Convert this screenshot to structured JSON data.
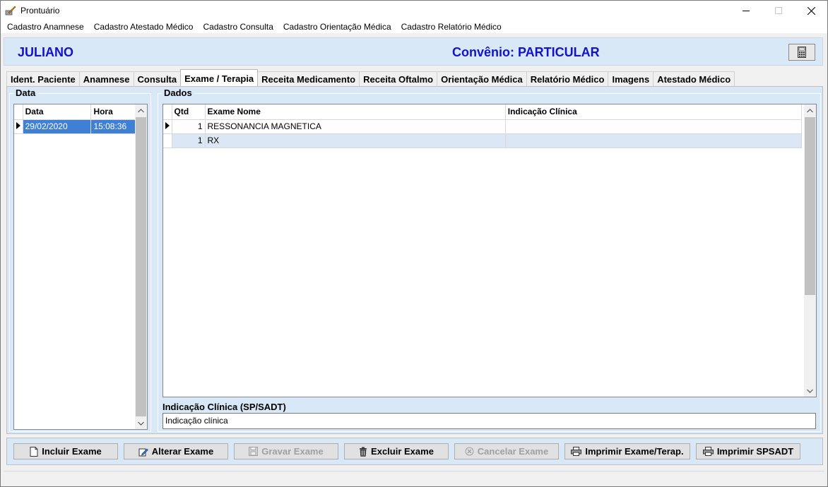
{
  "window": {
    "title": "Prontuário"
  },
  "menu": [
    "Cadastro Anamnese",
    "Cadastro Atestado Médico",
    "Cadastro Consulta",
    "Cadastro Orientação Médica",
    "Cadastro Relatório Médico"
  ],
  "header": {
    "patient_name": "JULIANO",
    "convenio": "Convênio: PARTICULAR"
  },
  "tabs": [
    {
      "label": "Ident. Paciente",
      "active": false
    },
    {
      "label": "Anamnese",
      "active": false
    },
    {
      "label": "Consulta",
      "active": false
    },
    {
      "label": "Exame / Terapia",
      "active": true
    },
    {
      "label": "Receita Medicamento",
      "active": false
    },
    {
      "label": "Receita Oftalmo",
      "active": false
    },
    {
      "label": "Orientação Médica",
      "active": false
    },
    {
      "label": "Relatório Médico",
      "active": false
    },
    {
      "label": "Imagens",
      "active": false
    },
    {
      "label": "Atestado Médico",
      "active": false
    }
  ],
  "data_group": {
    "title": "Data",
    "columns": [
      "Data",
      "Hora"
    ],
    "rows": [
      {
        "data": "29/02/2020",
        "hora": "15:08:36"
      }
    ]
  },
  "dados_group": {
    "title": "Dados",
    "columns": [
      "Qtd",
      "Exame Nome",
      "Indicação Clínica"
    ],
    "rows": [
      {
        "qtd": "1",
        "exame_nome": "RESSONANCIA MAGNETICA",
        "indicacao": ""
      },
      {
        "qtd": "1",
        "exame_nome": "RX",
        "indicacao": ""
      }
    ],
    "indicacao_label": "Indicação Clínica (SP/SADT)",
    "indicacao_value": "Indicação clínica"
  },
  "toolbar": {
    "incluir": "Incluir Exame",
    "alterar": "Alterar Exame",
    "gravar": "Gravar Exame",
    "excluir": "Excluir Exame",
    "cancelar": "Cancelar Exame",
    "imprimir_exame": "Imprimir Exame/Terap.",
    "imprimir_spsadt": "Imprimir SPSADT"
  },
  "colors": {
    "panel_bg": "#d9e8f6",
    "header_text": "#1212c8",
    "selection": "#3f80d6",
    "alt_row": "#dbe7f4"
  }
}
